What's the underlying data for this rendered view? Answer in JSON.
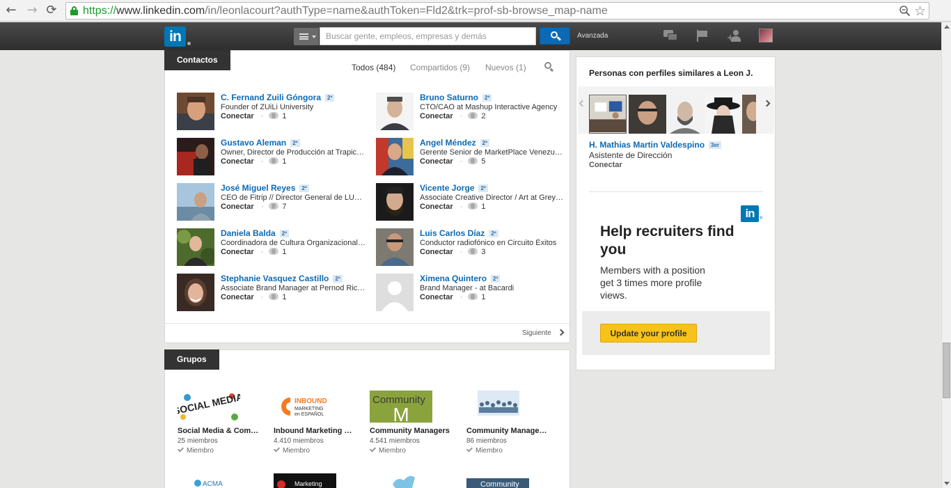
{
  "browser": {
    "url_protocol": "https://",
    "url_host": "www.linkedin.com",
    "url_rest": "/in/leonlacourt?authType=name&authToken=Fld2&trk=prof-sb-browse_map-name",
    "back_glyph": "←",
    "forward_glyph": "→",
    "reload_glyph": "⟳",
    "star_glyph": "☆"
  },
  "header": {
    "logo_text": "in",
    "search_placeholder": "Buscar gente, empleos, empresas y demás",
    "search_value": "",
    "advanced": "Avanzada",
    "icons": [
      "messages-icon",
      "flag-icon",
      "add-connection-icon",
      "profile-avatar"
    ]
  },
  "contacts": {
    "tab_label": "Contactos",
    "filters": {
      "all": "Todos (484)",
      "shared": "Compartidos (9)",
      "new": "Nuevos (1)"
    },
    "connect_label": "Conectar",
    "dot": "·",
    "items": [
      {
        "name": "C. Fernand Zuili Góngora",
        "degree": "2º",
        "headline": "Founder of ZUiLi University",
        "shared": "1"
      },
      {
        "name": "Bruno Saturno",
        "degree": "2º",
        "headline": "CTO/CAO at Mashup Interactive Agency",
        "shared": "2"
      },
      {
        "name": "Gustavo Aleman",
        "degree": "2º",
        "headline": "Owner, Director de Producción at Trapiche Films",
        "shared": "1"
      },
      {
        "name": "Angel Méndez",
        "degree": "2º",
        "headline": "Gerente Senior de MarketPlace Venezuela",
        "shared": "5"
      },
      {
        "name": "José Miguel Reyes",
        "degree": "2º",
        "headline": "CEO de Fitrip // Director General de LUMA",
        "shared": "7"
      },
      {
        "name": "Vicente Jorge",
        "degree": "2º",
        "headline": "Associate Creative Director / Art at Grey Group",
        "shared": "1"
      },
      {
        "name": "Daniela Balda",
        "degree": "2º",
        "headline": "Coordinadora de Cultura Organizacional en",
        "shared": "1"
      },
      {
        "name": "Luis Carlos Díaz",
        "degree": "2º",
        "headline": "Conductor radiofónico en Circuito Éxitos",
        "shared": "3"
      },
      {
        "name": "Stephanie Vasquez Castillo",
        "degree": "2º",
        "headline": "Associate Brand Manager at Pernod Ricard",
        "shared": "1"
      },
      {
        "name": "Ximena Quintero",
        "degree": "2º",
        "headline": "Brand Manager - at Bacardi",
        "shared": "1"
      }
    ],
    "next_label": "Siguiente"
  },
  "groups": {
    "tab_label": "Grupos",
    "items": [
      {
        "name": "Social Media & Community Managers",
        "members": "25 miembros",
        "status": "Miembro",
        "logo_text": "SOCIAL MEDIA"
      },
      {
        "name": "Inbound Marketing en Español",
        "members": "4.410 miembros",
        "status": "Miembro",
        "logo_text": "INBOUND MARKETING en ESPAÑOL"
      },
      {
        "name": "Community Managers",
        "members": "4.541 miembros",
        "status": "Miembro",
        "logo_text": "Community M"
      },
      {
        "name": "Community Managers Venezuela",
        "members": "86 miembros",
        "status": "Miembro",
        "logo_text": ""
      }
    ],
    "row2_logo_texts": [
      "ACMA",
      "Marketing",
      "",
      "Community"
    ]
  },
  "similar": {
    "title": "Personas con perfiles similares a Leon J.",
    "person": {
      "name": "H. Mathias Martin Valdespino",
      "degree": "3er",
      "headline": "Asistente de Dirección",
      "connect": "Conectar"
    }
  },
  "ad": {
    "logo_text": "in",
    "registered": "®",
    "title": "Help recruiters find you",
    "body": "Members with a position get 3 times more profile views.",
    "button": "Update your profile"
  },
  "colors": {
    "link_blue": "#0b6ab5",
    "linkedin_blue": "#0077b5",
    "ad_button": "#f7c21a",
    "tab_dark": "#333333"
  }
}
